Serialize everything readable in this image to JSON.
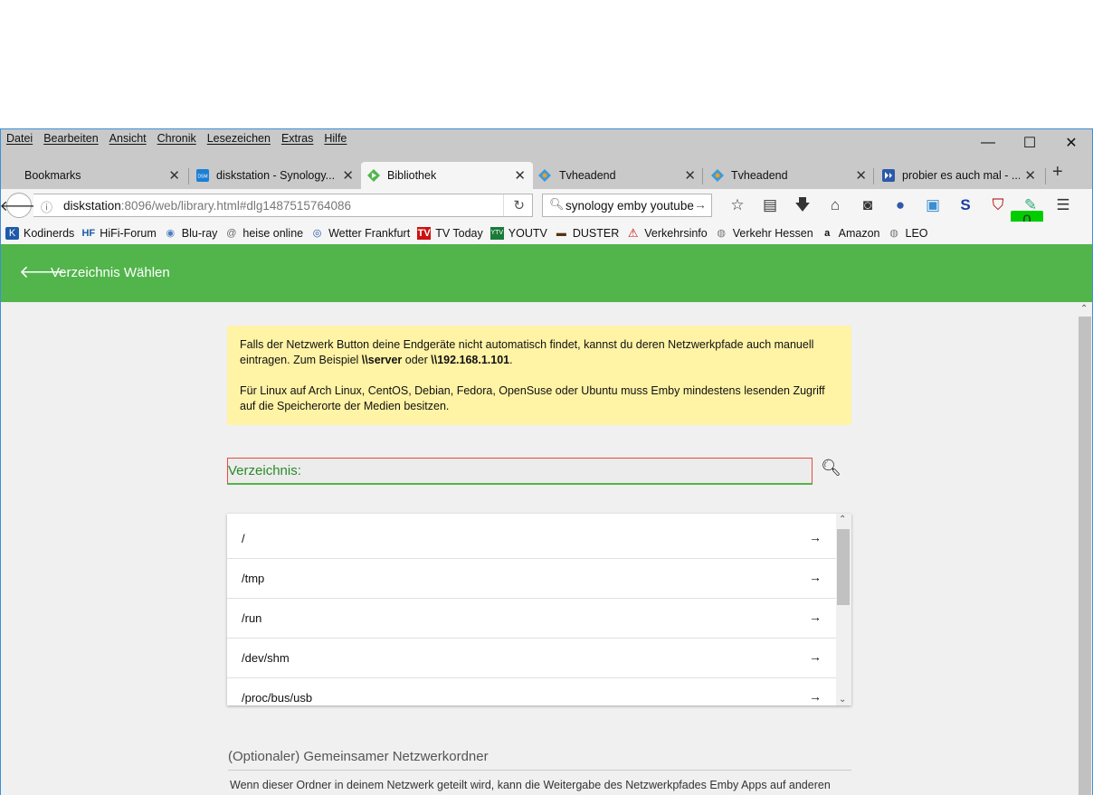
{
  "menubar": {
    "items": [
      "Datei",
      "Bearbeiten",
      "Ansicht",
      "Chronik",
      "Lesezeichen",
      "Extras",
      "Hilfe"
    ]
  },
  "window_controls": {
    "minimize": "—",
    "maximize": "☐",
    "close": "✕"
  },
  "tabs": [
    {
      "title": "Bookmarks"
    },
    {
      "title": "diskstation - Synology..."
    },
    {
      "title": "Bibliothek"
    },
    {
      "title": "Tvheadend"
    },
    {
      "title": "Tvheadend"
    },
    {
      "title": "probier es auch mal - ..."
    }
  ],
  "navbar": {
    "url_host": "diskstation",
    "url_rest": ":8096/web/library.html#dlg1487515764086",
    "search_text": "synology emby youtube",
    "addon_badge": "0"
  },
  "bookmarks": [
    {
      "label": "Kodinerds",
      "icon": "kodi-icon",
      "color": "#1e5aa8"
    },
    {
      "label": "HiFi-Forum",
      "icon": "hifi-icon",
      "color": "#1e5aa8"
    },
    {
      "label": "Blu-ray",
      "icon": "disc-icon",
      "color": "#4a7fc1"
    },
    {
      "label": "heise online",
      "icon": "heise-icon",
      "color": "#666666"
    },
    {
      "label": "Wetter Frankfurt",
      "icon": "globe-icon",
      "color": "#2255aa"
    },
    {
      "label": "TV Today",
      "icon": "tv-icon",
      "color": "#cc1111"
    },
    {
      "label": "YOUTV",
      "icon": "youtv-icon",
      "color": "#1a7a3a"
    },
    {
      "label": "DUSTER",
      "icon": "car-icon",
      "color": "#553311"
    },
    {
      "label": "Verkehrsinfo",
      "icon": "warning-icon",
      "color": "#cc1111"
    },
    {
      "label": "Verkehr Hessen",
      "icon": "globe-icon",
      "color": "#777777"
    },
    {
      "label": "Amazon",
      "icon": "amazon-icon",
      "color": "#111111"
    },
    {
      "label": "LEO",
      "icon": "globe-icon",
      "color": "#777777"
    }
  ],
  "app": {
    "header_title": "Verzeichnis Wählen",
    "accent": "#52b54b",
    "notice_p1_a": "Falls der Netzwerk Button deine Endgeräte nicht automatisch findet, kannst du deren Netzwerkpfade auch manuell eintragen. Zum Beispiel ",
    "notice_p1_b": "\\\\server",
    "notice_p1_c": " oder ",
    "notice_p1_d": "\\\\192.168.1.101",
    "notice_p1_e": ".",
    "notice_p2": "Für Linux auf Arch Linux, CentOS, Debian, Fedora, OpenSuse oder Ubuntu muss Emby mindestens lesenden Zugriff auf die Speicherorte der Medien besitzen.",
    "dir_label": "Verzeichnis:",
    "directories": [
      "/",
      "/tmp",
      "/run",
      "/dev/shm",
      "/proc/bus/usb"
    ],
    "share_title": "(Optionaler) Gemeinsamer Netzwerkordner",
    "share_desc": "Wenn dieser Ordner in deinem Netzwerk geteilt wird, kann die Weitergabe des Netzwerkpfades Emby Apps auf anderen"
  }
}
